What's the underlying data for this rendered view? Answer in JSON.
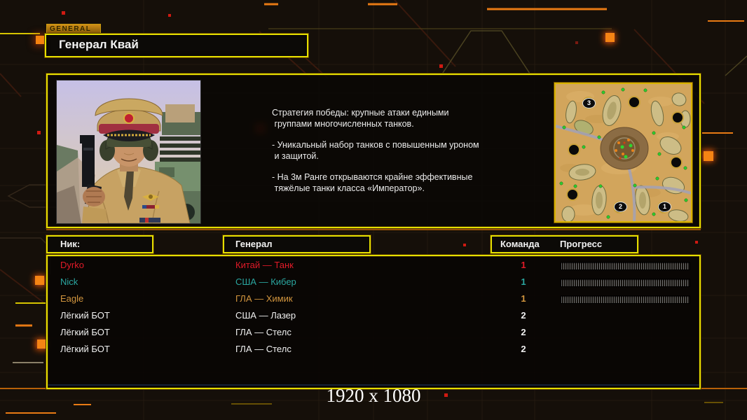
{
  "general_tab": {
    "label": "GENERAL"
  },
  "title": "Генерал Квай",
  "briefing": {
    "description_lines": [
      "Стратегия победы: крупные атаки едиными",
      " группами многочисленных танков.",
      "- Уникальный набор танков с повышенным уроном",
      " и защитой.",
      "- На 3м Ранге открываются крайне эффективные",
      " тяжёлые танки класса «Император»."
    ]
  },
  "minimap": {
    "markers": [
      {
        "label": "3"
      },
      {
        "label": "2"
      },
      {
        "label": "1"
      }
    ]
  },
  "table": {
    "headers": {
      "nick": "Ник:",
      "general": "Генерал",
      "team": "Команда",
      "progress": "Прогресс"
    },
    "rows": [
      {
        "nick": "Dyrko",
        "general": "Китай — Танк",
        "team": "1",
        "color": "#e11a28",
        "has_progress": true
      },
      {
        "nick": "Nick",
        "general": "США — Кибер",
        "team": "1",
        "color": "#2aa6a0",
        "has_progress": true
      },
      {
        "nick": "Eagle",
        "general": "ГЛА — Химик",
        "team": "1",
        "color": "#d2953e",
        "has_progress": true
      },
      {
        "nick": "Лёгкий БОТ",
        "general": "США — Лазер",
        "team": "2",
        "color": "#f0f0f0",
        "has_progress": false
      },
      {
        "nick": "Лёгкий БОТ",
        "general": "ГЛА — Стелс",
        "team": "2",
        "color": "#f0f0f0",
        "has_progress": false
      },
      {
        "nick": "Лёгкий БОТ",
        "general": "ГЛА — Стелс",
        "team": "2",
        "color": "#f0f0f0",
        "has_progress": false
      }
    ]
  },
  "footer": {
    "resolution": "1920 x 1080"
  },
  "colors": {
    "accent_yellow": "#e5df00",
    "accent_orange": "#e87a14",
    "background": "#150f09",
    "text": "#ececec"
  }
}
